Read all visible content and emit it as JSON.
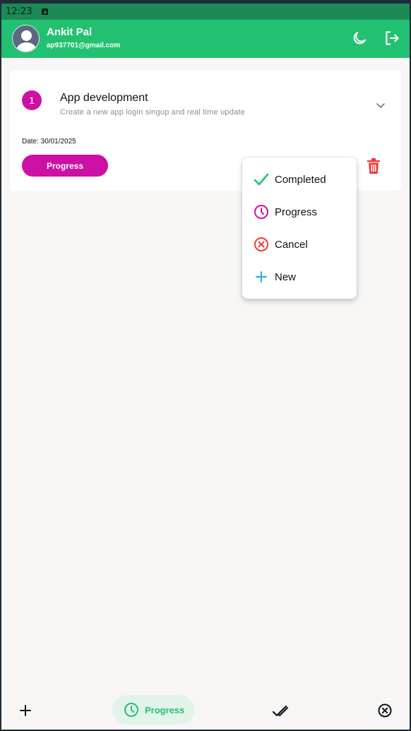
{
  "status_bar": {
    "time": "12:23"
  },
  "header": {
    "user_name": "Ankit Pal",
    "user_email": "ap937701@gmail.com",
    "theme_icon": "moon-icon",
    "logout_icon": "logout-icon"
  },
  "task": {
    "number": "1",
    "title": "App development",
    "description": "Create a new app login singup and real time update",
    "date": "Date: 30/01/2025",
    "status_label": "Progress",
    "status_color": "#cc10a3",
    "delete_icon": "trash-icon"
  },
  "status_menu": {
    "items": [
      {
        "label": "Completed",
        "icon": "check-icon",
        "color": "#22c171"
      },
      {
        "label": "Progress",
        "icon": "clock-icon",
        "color": "#cc10a3"
      },
      {
        "label": "Cancel",
        "icon": "cancel-icon",
        "color": "#ef3b3b"
      },
      {
        "label": "New",
        "icon": "plus-icon",
        "color": "#1ab5d6"
      }
    ]
  },
  "bottom_nav": {
    "items": [
      {
        "icon": "plus-icon"
      },
      {
        "label": "Progress",
        "icon": "clock-icon",
        "active": true
      },
      {
        "icon": "double-check-icon"
      },
      {
        "icon": "cancel-icon"
      }
    ]
  },
  "colors": {
    "accent": "#22c171",
    "status_bar": "#1b8a55",
    "delete": "#ef3b3b"
  }
}
